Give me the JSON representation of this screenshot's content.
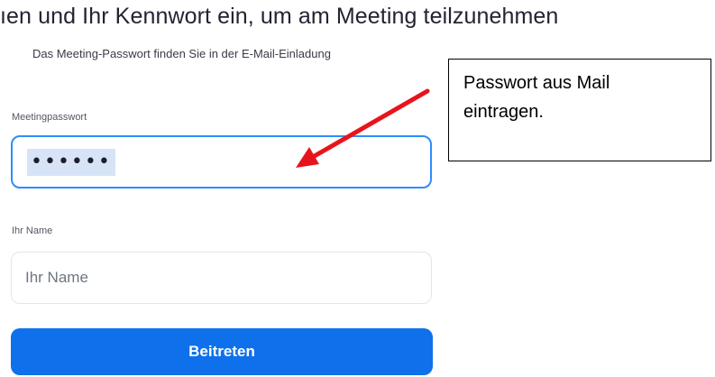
{
  "heading": {
    "text": "ıen und Ihr Kennwort ein, um am Meeting teilzunehmen"
  },
  "subheading": {
    "text": "Das Meeting-Passwort finden Sie in der E-Mail-Einladung"
  },
  "password_field": {
    "label": "Meetingpasswort",
    "masked_value": "••••••"
  },
  "name_field": {
    "label": "Ihr Name",
    "placeholder": "Ihr Name",
    "value": ""
  },
  "join_button": {
    "label": "Beitreten"
  },
  "annotation": {
    "line1": "Passwort aus Mail",
    "line2": "eintragen.",
    "arrow_color": "#e8141b"
  },
  "colors": {
    "accent": "#0e71eb",
    "focus_border": "#2d8cff",
    "arrow": "#e8141b"
  }
}
